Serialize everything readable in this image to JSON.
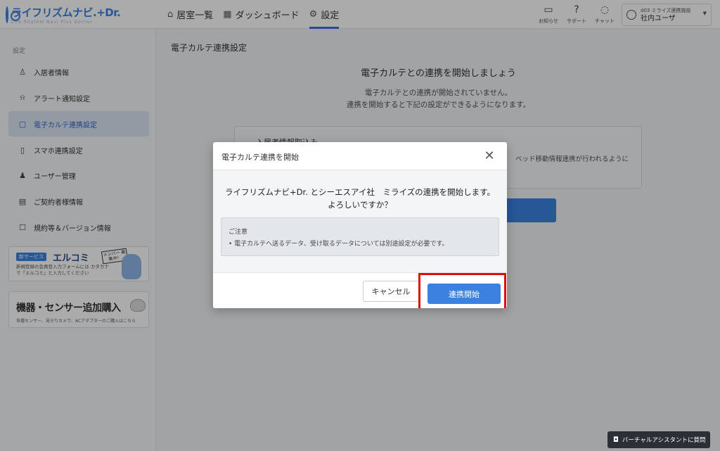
{
  "header": {
    "logo_text": "ライフリズムナビ.+Dr.",
    "logo_sub": "Life Rhythm Navi Plus Doctor",
    "nav": [
      {
        "label": "居室一覧",
        "icon": "home-icon"
      },
      {
        "label": "ダッシュボード",
        "icon": "dashboard-icon"
      },
      {
        "label": "設定",
        "icon": "gear-icon"
      }
    ],
    "icons": [
      {
        "label": "お知らせ",
        "icon": "notice-icon"
      },
      {
        "label": "サポート",
        "icon": "help-icon"
      },
      {
        "label": "チャット",
        "icon": "chat-icon"
      }
    ],
    "user": {
      "facility": "d03 ミライズ連携施設",
      "name": "社内ユーザ"
    }
  },
  "sidebar": {
    "section": "設定",
    "items": [
      {
        "label": "入居者情報",
        "icon": "resident-icon"
      },
      {
        "label": "アラート通知設定",
        "icon": "bell-icon"
      },
      {
        "label": "電子カルテ連携設定",
        "icon": "chart-link-icon"
      },
      {
        "label": "スマホ連携設定",
        "icon": "phone-icon"
      },
      {
        "label": "ユーザー管理",
        "icon": "users-icon"
      },
      {
        "label": "ご契約者様情報",
        "icon": "contract-icon"
      },
      {
        "label": "規約等＆バージョン情報",
        "icon": "terms-icon"
      }
    ],
    "banner1": {
      "tag": "新サービス",
      "title": "エルコミ",
      "desc": "新規登録の会員登入力フォームには カタカナで「エルコミ」と入力してください",
      "sign": "メンバー 募集中！"
    },
    "banner2": {
      "title": "機器・センサー追加購入",
      "desc": "各種センサー、見守りカメラ、ACアダプターのご購入はこちら"
    }
  },
  "main": {
    "page_title": "電子カルテ連携設定",
    "heading": "電子カルテとの連携を開始しましょう",
    "desc_line1": "電子カルテとの連携が開始されていません。",
    "desc_line2": "連携を開始すると下記の設定ができるようになります。",
    "box_title": "入居者情報取込み",
    "box_text": "ベッド移動情報連携が行われるように"
  },
  "modal": {
    "title": "電子カルテ連携を開始",
    "message_line1": "ライフリズムナビ+Dr. とシーエスアイ社　ミライズの連携を開始します。",
    "message_line2": "よろしいですか？",
    "notice_title": "ご注意",
    "notice_item": "•  電子カルテへ送るデータ、受け取るデータについては別途設定が必要です。",
    "cancel_label": "キャンセル",
    "start_label": "連携開始",
    "close_glyph": "✕"
  },
  "assistant": {
    "label": "バーチャルアシスタントに質問"
  }
}
